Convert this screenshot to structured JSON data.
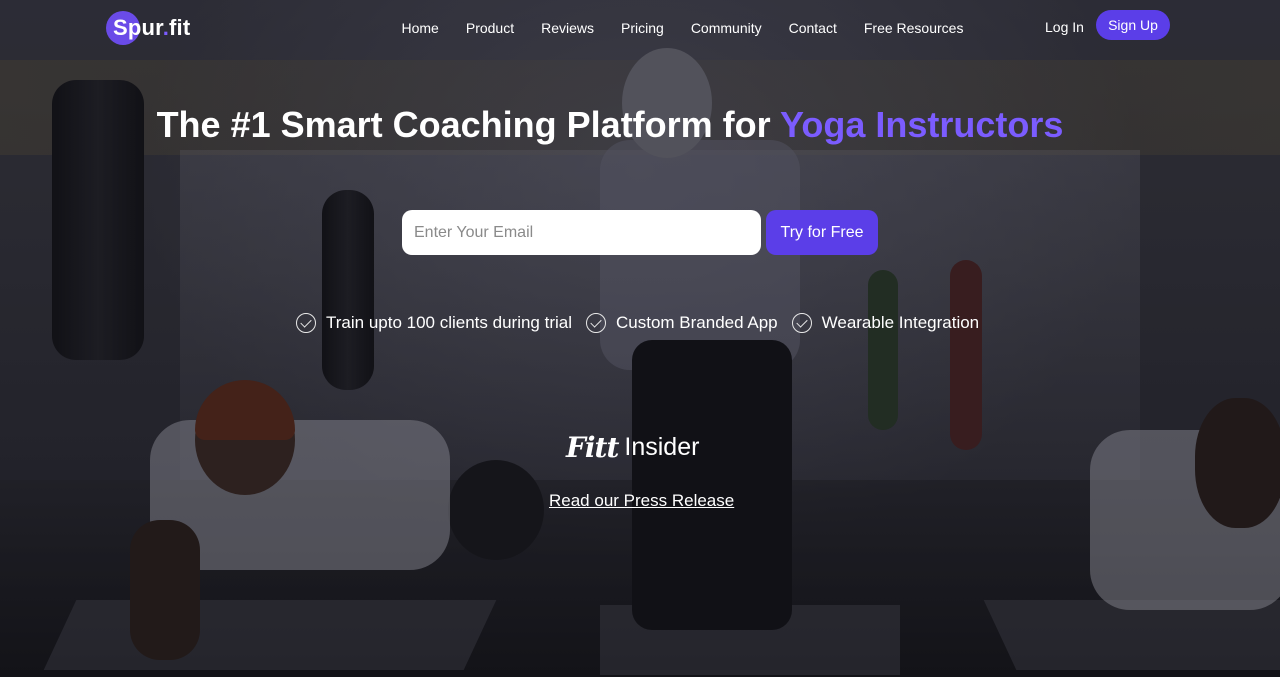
{
  "brand": {
    "name_part1": "Spur",
    "dot": ".",
    "name_part2": "fit",
    "accent_color": "#5b3ee8",
    "headline_accent_color": "#7b5cff"
  },
  "nav": {
    "links": [
      "Home",
      "Product",
      "Reviews",
      "Pricing",
      "Community",
      "Contact",
      "Free Resources"
    ],
    "login_label": "Log In",
    "signup_label": "Sign Up"
  },
  "hero": {
    "headline_prefix": "The #1 Smart Coaching Platform for ",
    "headline_accent": "Yoga Instructors",
    "email_placeholder": "Enter Your Email",
    "email_value": "",
    "cta_label": "Try for Free",
    "features": [
      {
        "icon": "check-circle-icon",
        "text": "Train upto 100 clients during trial"
      },
      {
        "icon": "check-circle-icon",
        "text": "Custom Branded App"
      },
      {
        "icon": "check-circle-icon",
        "text": "Wearable Integration"
      }
    ]
  },
  "press": {
    "logo_part1": "Fitt",
    "logo_part2": "Insider",
    "link_label": "Read our Press Release"
  }
}
